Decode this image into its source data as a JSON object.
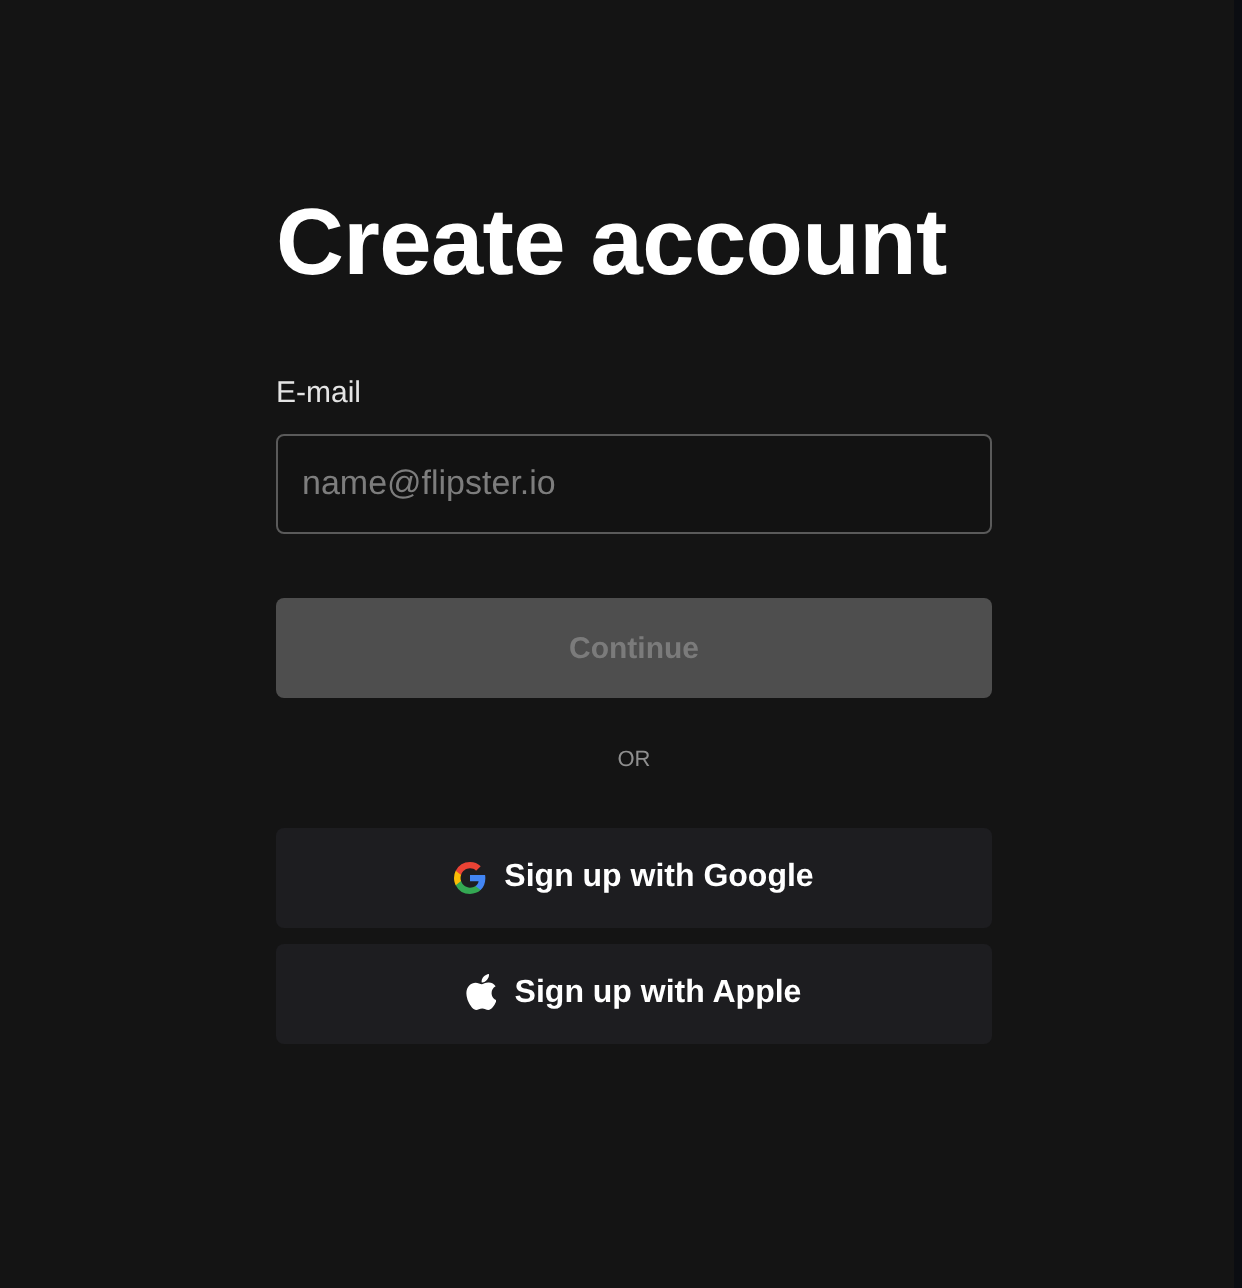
{
  "title": "Create account",
  "email": {
    "label": "E-mail",
    "placeholder": "name@flipster.io"
  },
  "continue_button": {
    "label": "Continue",
    "disabled": true
  },
  "divider": {
    "label": "OR"
  },
  "social_buttons": [
    {
      "label": "Sign up with Google",
      "kind": "google"
    },
    {
      "label": "Sign up with Apple",
      "kind": "apple"
    }
  ]
}
